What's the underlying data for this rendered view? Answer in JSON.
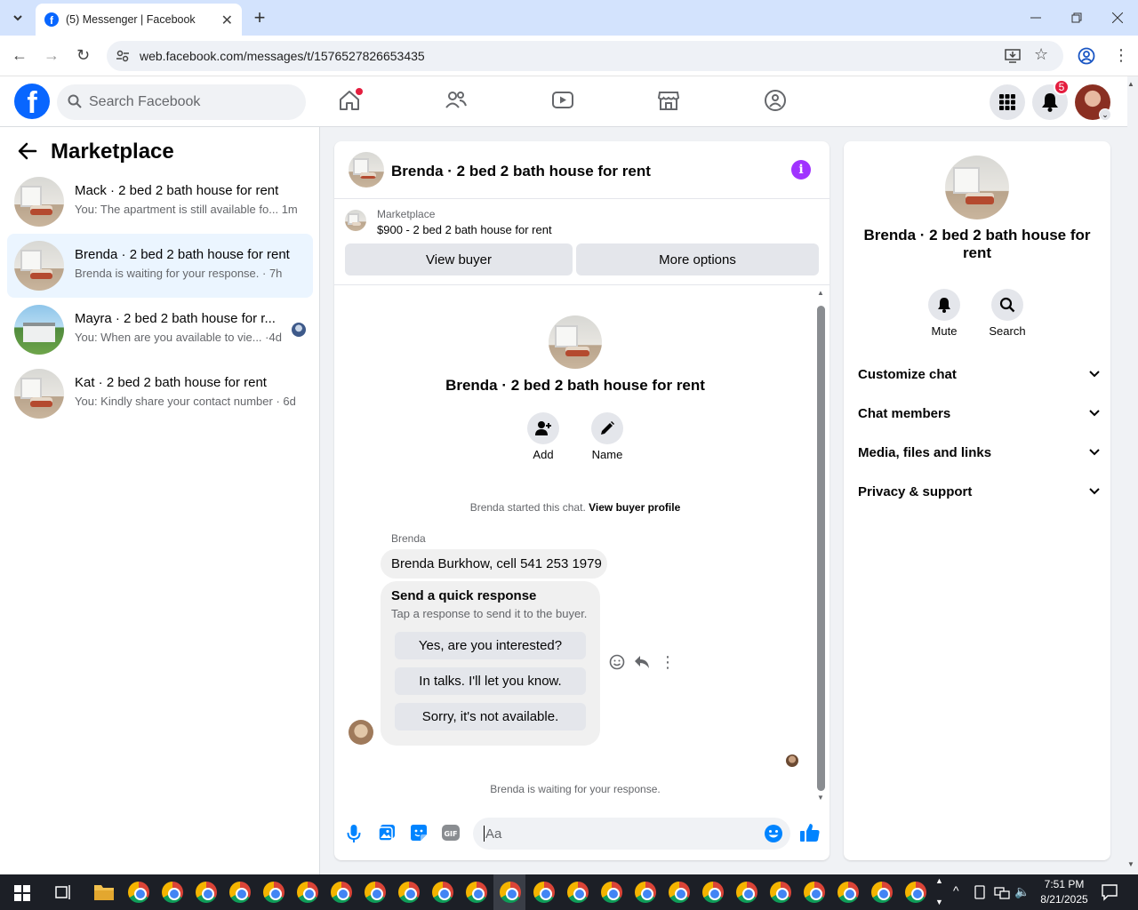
{
  "browser": {
    "tab_title": "(5) Messenger | Facebook",
    "url": "web.facebook.com/messages/t/1576527826653435"
  },
  "fb": {
    "search_placeholder": "Search Facebook",
    "notif_count": "5"
  },
  "left": {
    "title": "Marketplace",
    "conversations": [
      {
        "title": "Mack · 2 bed 2 bath house for rent",
        "preview": "You: The apartment is still available fo...",
        "time": "1m",
        "thumb": "room"
      },
      {
        "title": "Brenda · 2 bed 2 bath house for rent",
        "preview": "Brenda is waiting for your response.",
        "time": "7h",
        "thumb": "room"
      },
      {
        "title": "Mayra · 2 bed 2 bath house for r...",
        "preview": "You: When are you available to vie...",
        "time": "4d",
        "thumb": "house"
      },
      {
        "title": "Kat · 2 bed 2 bath house for rent",
        "preview": "You: Kindly share your contact number",
        "time": "6d",
        "thumb": "room"
      }
    ]
  },
  "chat": {
    "header_title": "Brenda · 2 bed 2 bath house for rent",
    "marketplace_label": "Marketplace",
    "listing": "$900 - 2 bed 2 bath house for rent",
    "view_buyer": "View buyer",
    "more_options": "More options",
    "center_title": "Brenda · 2 bed 2 bath house for rent",
    "add_label": "Add",
    "name_label": "Name",
    "started_text": "Brenda started this chat.",
    "view_profile": "View buyer profile",
    "sender": "Brenda",
    "message": "Brenda Burkhow, cell 541 253 1979",
    "qr_title": "Send a quick response",
    "qr_sub": "Tap a response to send it to the buyer.",
    "qr_options": [
      "Yes, are you interested?",
      "In talks. I'll let you know.",
      "Sorry, it's not available."
    ],
    "waiting": "Brenda is waiting for your response.",
    "input_placeholder": "Aa"
  },
  "right": {
    "title": "Brenda · 2 bed 2 bath house for rent",
    "mute": "Mute",
    "search": "Search",
    "sections": [
      "Customize chat",
      "Chat members",
      "Media, files and links",
      "Privacy & support"
    ]
  },
  "taskbar": {
    "time": "7:51 PM",
    "date": "8/21/2025"
  },
  "colors": {
    "fb_blue": "#0866ff",
    "messenger_blue": "#0084ff",
    "info_purple": "#a033ff",
    "badge_red": "#e41e3f"
  }
}
